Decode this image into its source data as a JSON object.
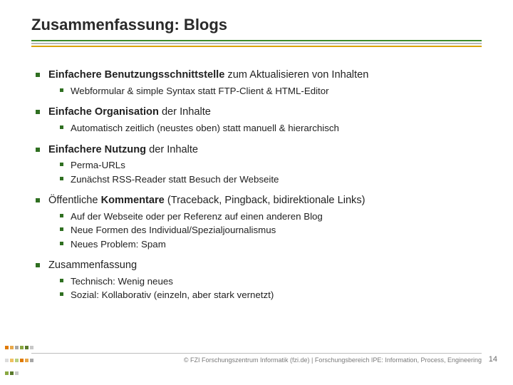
{
  "title": "Zusammenfassung: Blogs",
  "sections": [
    {
      "strong": "Einfachere Benutzungsschnittstelle",
      "rest": " zum Aktualisieren von Inhalten",
      "subs": [
        "Webformular & simple Syntax statt FTP-Client & HTML-Editor"
      ]
    },
    {
      "strong": "Einfache Organisation",
      "rest": " der Inhalte",
      "subs": [
        "Automatisch zeitlich (neustes oben) statt manuell & hierarchisch"
      ]
    },
    {
      "strong": "Einfachere Nutzung",
      "rest": " der Inhalte",
      "subs": [
        "Perma-URLs",
        "Zunächst RSS-Reader statt Besuch der Webseite"
      ]
    },
    {
      "strong": "",
      "rest_before": "Öffentliche ",
      "rest_strong": "Kommentare",
      "rest_after": " (Traceback, Pingback, bidirektionale Links)",
      "subs": [
        "Auf der Webseite oder per Referenz auf einen anderen Blog",
        "Neue Formen des Individual/Spezialjournalismus",
        "Neues Problem: Spam"
      ]
    },
    {
      "strong": "",
      "rest": "Zusammenfassung",
      "subs": [
        "Technisch: Wenig neues",
        "Sozial: Kollaborativ (einzeln, aber stark vernetzt)"
      ]
    }
  ],
  "footer": "© FZI Forschungszentrum Informatik (fzi.de) | Forschungsbereich IPE: Information, Process, Engineering",
  "page": "14",
  "colors": {
    "accent": "#3c8a2a",
    "gold": "#d9a300",
    "grey": "#b7b7b7"
  },
  "dots_palette": [
    "#e07a00",
    "#e8a84a",
    "#a7a7a7",
    "#8aa843",
    "#5a7a2c",
    "#c8c8c8",
    "#dcdcdc",
    "#f0c060",
    "#b8d080"
  ]
}
